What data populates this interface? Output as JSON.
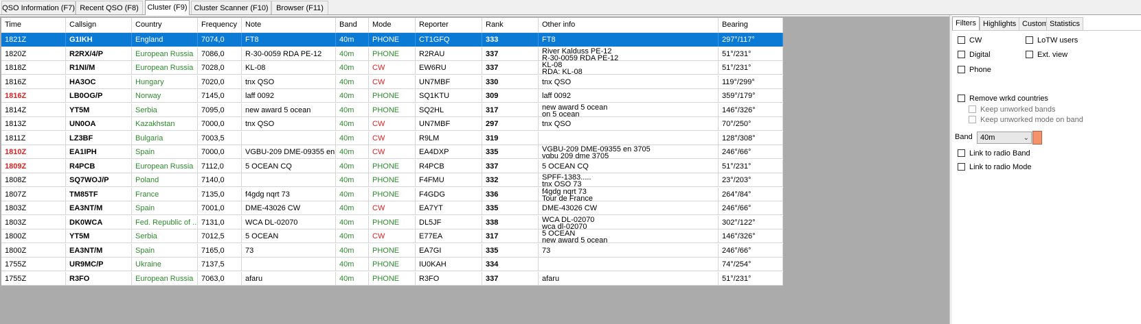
{
  "top_tabs": [
    "QSO Information (F7)",
    "Recent QSO (F8)",
    "Cluster (F9)",
    "Cluster Scanner (F10)",
    "Browser (F11)"
  ],
  "active_tab": "Cluster (F9)",
  "columns": [
    "Time",
    "Callsign",
    "Country",
    "Frequency",
    "Note",
    "Band",
    "Mode",
    "Reporter",
    "Rank",
    "Other info",
    "Bearing"
  ],
  "rows": [
    {
      "time": "1821Z",
      "callsign": "G1IKH",
      "country": "England",
      "frequency": "7074,0",
      "note": "FT8",
      "band": "40m",
      "mode": "PHONE",
      "reporter": "CT1GFQ",
      "rank": "333",
      "other1": "FT8",
      "other2": "",
      "bearing": "297°/117°",
      "selected": true
    },
    {
      "time": "1820Z",
      "callsign": "R2RX/4/P",
      "country": "European Russia",
      "frequency": "7086,0",
      "note": "R-30-0059 RDA PE-12",
      "band": "40m",
      "mode": "PHONE",
      "reporter": "R2RAU",
      "rank": "337",
      "other1": "River Kalduss PE-12",
      "other2": "R-30-0059 RDA PE-12",
      "bearing": "51°/231°"
    },
    {
      "time": "1818Z",
      "callsign": "R1NI/M",
      "country": "European Russia",
      "frequency": "7028,0",
      "note": "KL-08",
      "band": "40m",
      "mode": "CW",
      "reporter": "EW6RU",
      "rank": "337",
      "other1": "KL-08",
      "other2": "RDA: KL-08",
      "bearing": "51°/231°"
    },
    {
      "time": "1816Z",
      "callsign": "HA3OC",
      "country": "Hungary",
      "frequency": "7020,0",
      "note": "tnx QSO",
      "band": "40m",
      "mode": "CW",
      "reporter": "UN7MBF",
      "rank": "330",
      "other1": "tnx QSO",
      "other2": "",
      "bearing": "119°/299°"
    },
    {
      "time": "1816Z",
      "callsign": "LB0OG/P",
      "country": "Norway",
      "frequency": "7145,0",
      "note": "laff 0092",
      "band": "40m",
      "mode": "PHONE",
      "reporter": "SQ1KTU",
      "rank": "309",
      "other1": "laff 0092",
      "other2": "",
      "bearing": "359°/179°",
      "time_red": true
    },
    {
      "time": "1814Z",
      "callsign": "YT5M",
      "country": "Serbia",
      "frequency": "7095,0",
      "note": "new award 5 ocean",
      "band": "40m",
      "mode": "PHONE",
      "reporter": "SQ2HL",
      "rank": "317",
      "other1": "new award 5 ocean",
      "other2": "on 5 ocean",
      "bearing": "146°/326°"
    },
    {
      "time": "1813Z",
      "callsign": "UN0OA",
      "country": "Kazakhstan",
      "frequency": "7000,0",
      "note": "tnx QSO",
      "band": "40m",
      "mode": "CW",
      "reporter": "UN7MBF",
      "rank": "297",
      "other1": "tnx QSO",
      "other2": "",
      "bearing": "70°/250°"
    },
    {
      "time": "1811Z",
      "callsign": "LZ3BF",
      "country": "Bulgaria",
      "frequency": "7003,5",
      "note": "",
      "band": "40m",
      "mode": "CW",
      "reporter": "R9LM",
      "rank": "319",
      "other1": "",
      "other2": "",
      "bearing": "128°/308°"
    },
    {
      "time": "1810Z",
      "callsign": "EA1IPH",
      "country": "Spain",
      "frequency": "7000,0",
      "note": "VGBU-209 DME-09355 en...",
      "band": "40m",
      "mode": "CW",
      "reporter": "EA4DXP",
      "rank": "335",
      "other1": "VGBU-209 DME-09355 en 3705",
      "other2": "vgbu 209 dme 3705",
      "bearing": "246°/66°",
      "time_red": true
    },
    {
      "time": "1809Z",
      "callsign": "R4PCB",
      "country": "European Russia",
      "frequency": "7112,0",
      "note": "5 OCEAN CQ",
      "band": "40m",
      "mode": "PHONE",
      "reporter": "R4PCB",
      "rank": "337",
      "other1": "5 OCEAN CQ",
      "other2": "",
      "bearing": "51°/231°",
      "time_red": true
    },
    {
      "time": "1808Z",
      "callsign": "SQ7WOJ/P",
      "country": "Poland",
      "frequency": "7140,0",
      "note": "",
      "band": "40m",
      "mode": "PHONE",
      "reporter": "F4FMU",
      "rank": "332",
      "other1": "SPFF-1383.....",
      "other2": "tnx QSO 73",
      "bearing": "23°/203°"
    },
    {
      "time": "1807Z",
      "callsign": "TM85TF",
      "country": "France",
      "frequency": "7135,0",
      "note": "f4gdg nqrt 73",
      "band": "40m",
      "mode": "PHONE",
      "reporter": "F4GDG",
      "rank": "336",
      "other1": "f4gdg nqrt 73",
      "other2": "Tour de France",
      "bearing": "264°/84°"
    },
    {
      "time": "1803Z",
      "callsign": "EA3NT/M",
      "country": "Spain",
      "frequency": "7001,0",
      "note": "DME-43026 CW",
      "band": "40m",
      "mode": "CW",
      "reporter": "EA7YT",
      "rank": "335",
      "other1": "DME-43026 CW",
      "other2": "",
      "bearing": "246°/66°"
    },
    {
      "time": "1803Z",
      "callsign": "DK0WCA",
      "country": "Fed. Republic of ...",
      "frequency": "7131,0",
      "note": "WCA DL-02070",
      "band": "40m",
      "mode": "PHONE",
      "reporter": "DL5JF",
      "rank": "338",
      "other1": "WCA DL-02070",
      "other2": "wca dl-02070",
      "bearing": "302°/122°"
    },
    {
      "time": "1800Z",
      "callsign": "YT5M",
      "country": "Serbia",
      "frequency": "7012,5",
      "note": "5 OCEAN",
      "band": "40m",
      "mode": "CW",
      "reporter": "E77EA",
      "rank": "317",
      "other1": "5 OCEAN",
      "other2": "new award 5 ocean",
      "bearing": "146°/326°"
    },
    {
      "time": "1800Z",
      "callsign": "EA3NT/M",
      "country": "Spain",
      "frequency": "7165,0",
      "note": "73",
      "band": "40m",
      "mode": "PHONE",
      "reporter": "EA7GI",
      "rank": "335",
      "other1": "73",
      "other2": "",
      "bearing": "246°/66°"
    },
    {
      "time": "1755Z",
      "callsign": "UR9MC/P",
      "country": "Ukraine",
      "frequency": "7137,5",
      "note": "",
      "band": "40m",
      "mode": "PHONE",
      "reporter": "IU0KAH",
      "rank": "334",
      "other1": "",
      "other2": "",
      "bearing": "74°/254°"
    },
    {
      "time": "1755Z",
      "callsign": "R3FO",
      "country": "European Russia",
      "frequency": "7063,0",
      "note": "afaru",
      "band": "40m",
      "mode": "PHONE",
      "reporter": "R3FO",
      "rank": "337",
      "other1": "afaru",
      "other2": "",
      "bearing": "51°/231°"
    }
  ],
  "right_panel": {
    "tabs": [
      "Filters",
      "Highlights",
      "Custom",
      "Statistics"
    ],
    "active_tab": "Filters",
    "cw": "CW",
    "digital": "Digital",
    "phone": "Phone",
    "lotw": "LoTW users",
    "ext_view": "Ext. view",
    "remove_wrkd": "Remove wrkd countries",
    "keep_bands": "Keep unworked bands",
    "keep_mode": "Keep unworked mode on band",
    "band_label": "Band",
    "band_value": "40m",
    "band_color": "#f4936b",
    "link_band": "Link to radio Band",
    "link_mode": "Link to radio Mode"
  },
  "colors": {
    "selected_row": "#0a7ad4",
    "country_green": "#2e8b2e",
    "cw_red": "#e02020",
    "grid_background": "#ababab"
  }
}
